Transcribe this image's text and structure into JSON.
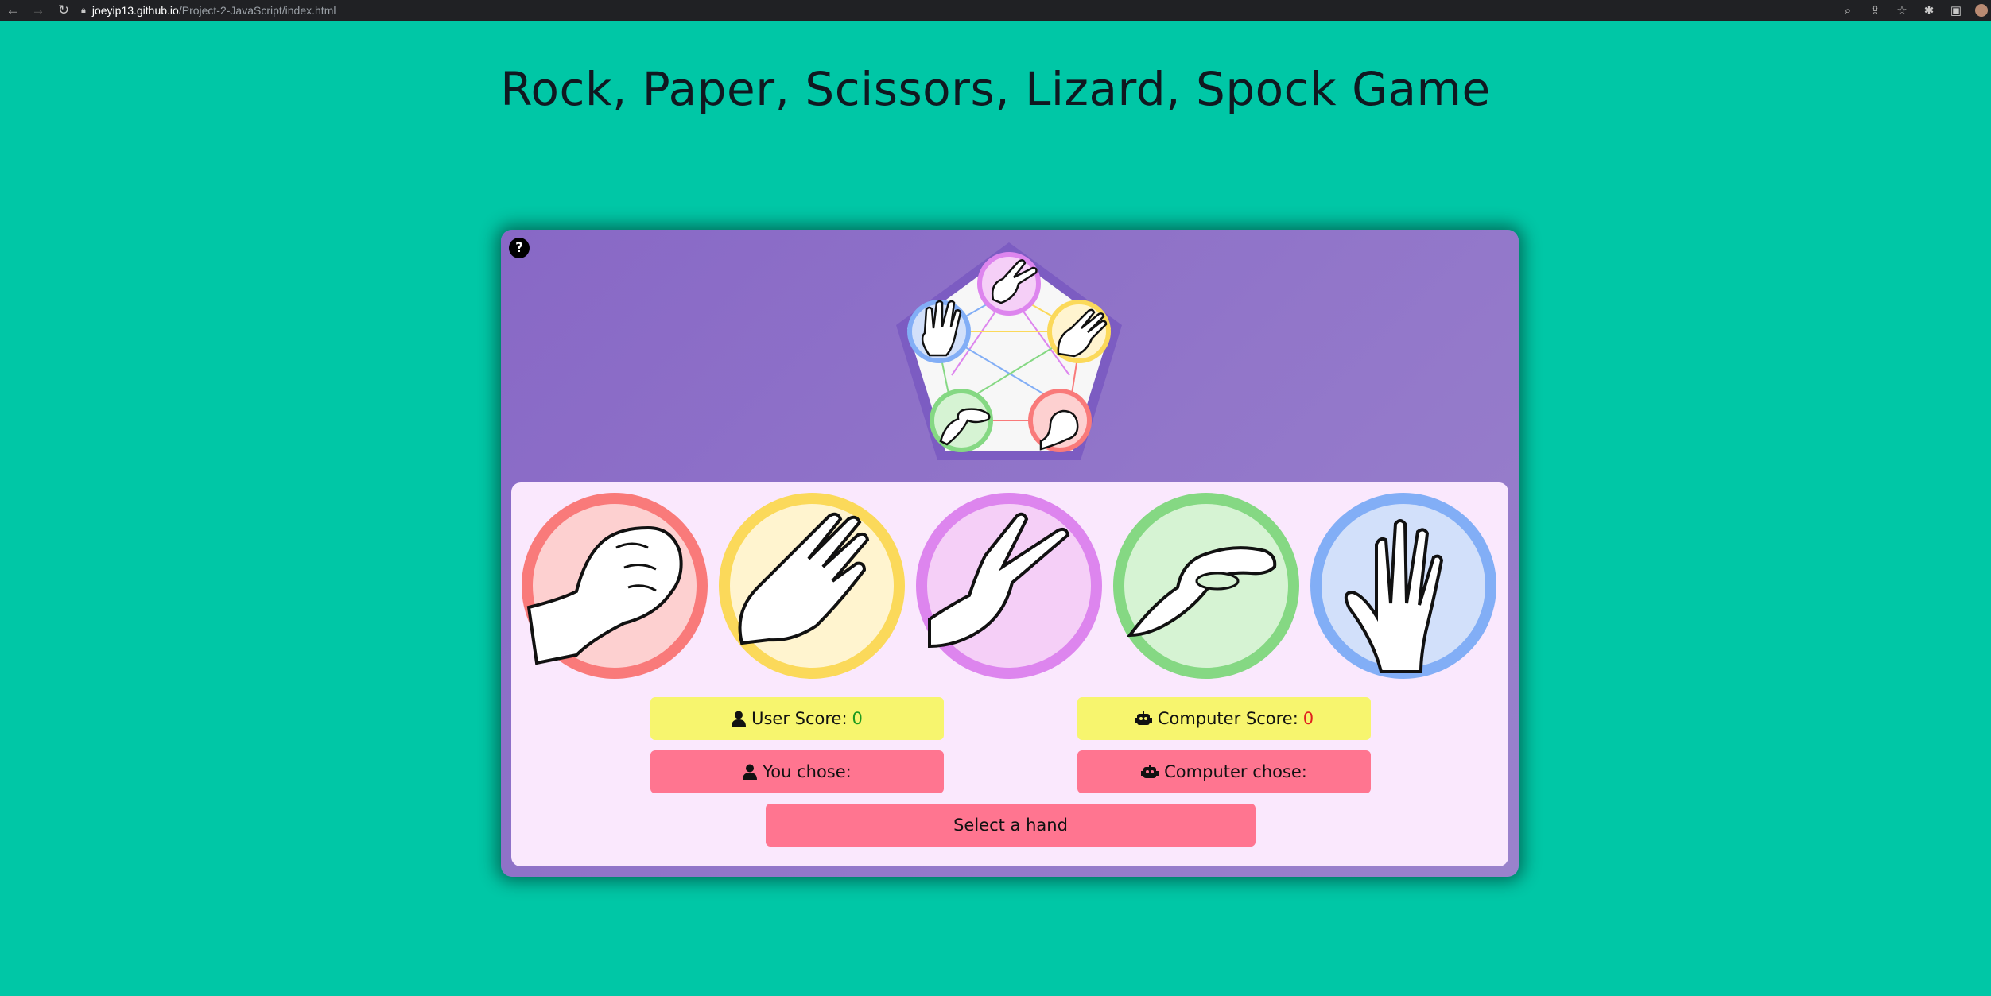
{
  "browser": {
    "url_host": "joeyip13.github.io",
    "url_path": "/Project-2-JavaScript/index.html"
  },
  "page": {
    "title": "Rock, Paper, Scissors, Lizard, Spock Game"
  },
  "game": {
    "help_label": "?",
    "hands": [
      {
        "name": "rock",
        "ring_color": "#f97a7a",
        "fill_color": "#fdd0d0"
      },
      {
        "name": "paper",
        "ring_color": "#fbd95a",
        "fill_color": "#fff4cf"
      },
      {
        "name": "scissors",
        "ring_color": "#dd85ee",
        "fill_color": "#f5cff7"
      },
      {
        "name": "lizard",
        "ring_color": "#85d883",
        "fill_color": "#d6f3d3"
      },
      {
        "name": "spock",
        "ring_color": "#82aef6",
        "fill_color": "#d2e0fa"
      }
    ],
    "user_score_label": "User Score:",
    "user_score_value": "0",
    "computer_score_label": "Computer Score:",
    "computer_score_value": "0",
    "you_chose_label": "You chose:",
    "computer_chose_label": "Computer chose:",
    "status_message": "Select a hand"
  },
  "colors": {
    "page_background": "#00c7a6",
    "card_purple": "#8868c6",
    "panel_pink": "#fae8fd",
    "score_yellow": "#f7f56e",
    "choice_pink": "#ff7590",
    "score_green": "#1e9a1e",
    "score_red": "#e0201e"
  }
}
